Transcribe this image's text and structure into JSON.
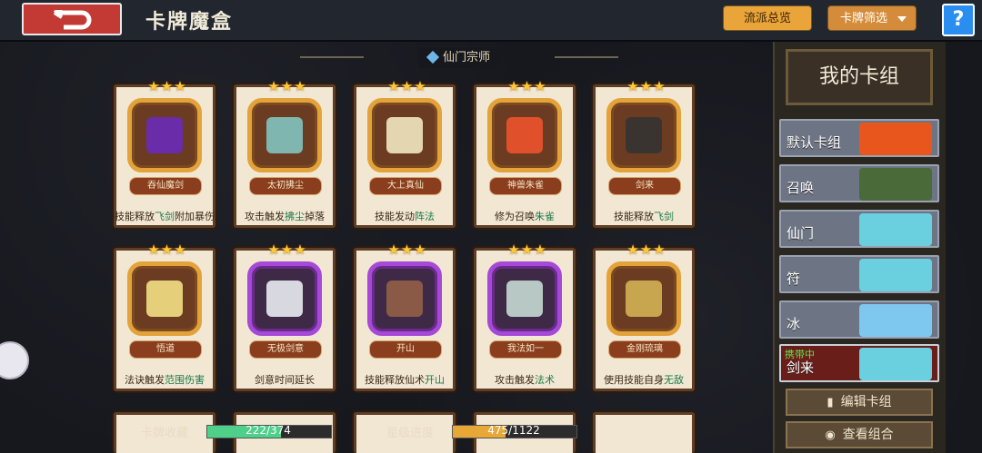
{
  "header": {
    "title": "卡牌魔盒",
    "faction_overview": "流派总览",
    "card_filter": "卡牌筛选",
    "help": "?"
  },
  "section": {
    "label": "仙门宗师"
  },
  "cards": [
    {
      "name": "吞仙魔剑",
      "desc_pre": "技能释放",
      "desc_hl": "飞剑",
      "desc_post": "附加暴伤",
      "frame": "gold",
      "stars": "★★★",
      "art": "#6a2ca8"
    },
    {
      "name": "太初拂尘",
      "desc_pre": "攻击触发",
      "desc_hl": "拂尘",
      "desc_post": "掉落",
      "frame": "gold",
      "stars": "★★★",
      "art": "#7fb6b0"
    },
    {
      "name": "大上真仙",
      "desc_pre": "技能发动",
      "desc_hl": "阵法",
      "desc_post": "",
      "frame": "gold",
      "stars": "★★★",
      "art": "#e4d6b0"
    },
    {
      "name": "神兽朱雀",
      "desc_pre": "修为召唤",
      "desc_hl": "朱雀",
      "desc_post": "",
      "frame": "gold",
      "stars": "★★★",
      "art": "#e0502a"
    },
    {
      "name": "剑来",
      "desc_pre": "技能释放",
      "desc_hl": "飞剑",
      "desc_post": "",
      "frame": "gold",
      "stars": "★★★",
      "art": "#3a3430"
    },
    {
      "name": "悟道",
      "desc_pre": "法诀触发",
      "desc_hl": "范围伤害",
      "desc_post": "",
      "frame": "gold",
      "stars": "★★★",
      "art": "#e6cf7a"
    },
    {
      "name": "无极剑意",
      "desc_pre": "剑意时间延长",
      "desc_hl": "",
      "desc_post": "",
      "frame": "purple",
      "stars": "★★★",
      "art": "#d8d8e0"
    },
    {
      "name": "开山",
      "desc_pre": "技能释放仙术",
      "desc_hl": "开山",
      "desc_post": "",
      "frame": "purple",
      "stars": "★★★",
      "art": "#8a5a46"
    },
    {
      "name": "我法如一",
      "desc_pre": "攻击触发",
      "desc_hl": "法术",
      "desc_post": "",
      "frame": "purple",
      "stars": "★★★",
      "art": "#b8c8c4"
    },
    {
      "name": "金刚琉璃",
      "desc_pre": "使用技能自身",
      "desc_hl": "无敌",
      "desc_post": "",
      "frame": "gold",
      "stars": "★★★",
      "art": "#c8a650"
    }
  ],
  "panel": {
    "title": "我的卡组",
    "decks": [
      {
        "label": "默认卡组",
        "art": "#e8561e"
      },
      {
        "label": "召唤",
        "art": "#4a6a3a"
      },
      {
        "label": "仙门",
        "art": "#6ad0e0"
      },
      {
        "label": "符",
        "art": "#6ad0e0"
      },
      {
        "label": "冰",
        "art": "#7ec8f0"
      },
      {
        "label": "剑来",
        "art": "#6ad0e0",
        "carry": "携带中"
      }
    ],
    "edit_deck": "编辑卡组",
    "view_combo": "查看组合"
  },
  "progress": [
    {
      "label": "卡牌收藏",
      "value": "222/374",
      "fraction": 0.594,
      "color": "#4fd08a"
    },
    {
      "label": "星级进度",
      "value": "475/1122",
      "fraction": 0.423,
      "color": "#e8a838"
    }
  ]
}
